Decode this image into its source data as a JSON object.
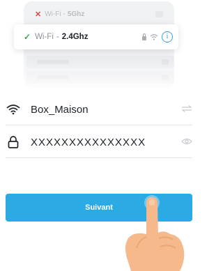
{
  "wifi_list": {
    "network_5ghz": {
      "status_icon": "x-icon",
      "prefix": "Wi-Fi",
      "separator": "-",
      "band": "5Ghz"
    },
    "network_24ghz": {
      "status_icon": "check-icon",
      "prefix": "Wi-Fi",
      "separator": "-",
      "band": "2.4Ghz",
      "info_symbol": "i"
    }
  },
  "form": {
    "ssid": {
      "icon": "wifi-icon",
      "value": "Box_Maison",
      "trailing_icon": "swap-icon"
    },
    "password": {
      "icon": "lock-icon",
      "value": "XXXXXXXXXXXXXXX",
      "trailing_icon": "eye-icon"
    }
  },
  "next_button": {
    "label": "Suivant"
  },
  "pointer": {
    "icon": "hand-pointer-icon"
  },
  "colors": {
    "accent": "#2baae4",
    "error": "#e04848",
    "success": "#3ba35a",
    "info": "#3b9ce6",
    "hand": "#f5b98b"
  }
}
